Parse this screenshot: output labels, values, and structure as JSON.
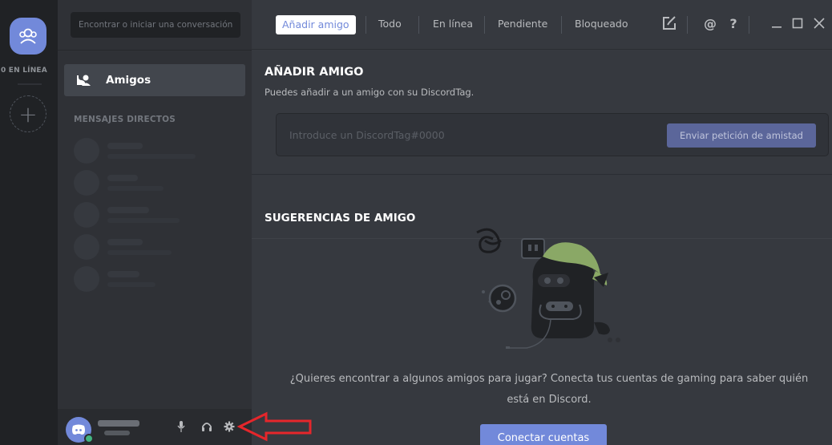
{
  "rail": {
    "online_label": "0 EN LÍNEA"
  },
  "channels": {
    "search_placeholder": "Encontrar o iniciar una conversación",
    "friends_label": "Amigos",
    "dm_header": "MENSAJES DIRECTOS"
  },
  "topbar": {
    "tabs": [
      "Añadir amigo",
      "Todo",
      "En línea",
      "Pendiente",
      "Bloqueado"
    ],
    "icons": [
      "new-group-dm-icon",
      "mention-icon",
      "help-icon",
      "minimize-icon",
      "maximize-icon",
      "close-icon"
    ],
    "mention_glyph": "@",
    "help_glyph": "?"
  },
  "add_friend": {
    "title": "AÑADIR AMIGO",
    "description": "Puedes añadir a un amigo con su DiscordTag.",
    "input_placeholder": "Introduce un DiscordTag#0000",
    "send_button": "Enviar petición de amistad"
  },
  "suggestions": {
    "title": "SUGERENCIAS DE AMIGO",
    "text": "¿Quieres encontrar a algunos amigos para jugar? Conecta tus cuentas de gaming para saber quién está en Discord.",
    "connect_button": "Conectar cuentas"
  },
  "colors": {
    "accent": "#7289da",
    "online_status": "#43b581",
    "annotation_arrow": "#e5262b"
  }
}
